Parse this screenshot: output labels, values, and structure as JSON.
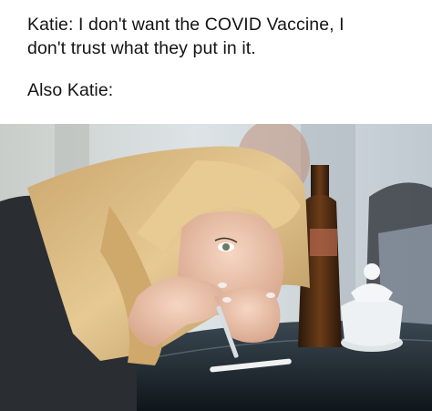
{
  "caption": {
    "line1": "Katie: I don't want the COVID Vaccine, I",
    "line2": "don't trust what they put in it.",
    "line3": "Also Katie:"
  },
  "photo": {
    "subject": "blonde-woman-leaning-over-table",
    "colors": {
      "hair": "#d9b77e",
      "skin": "#efc9b2",
      "shirt": "#2a2d31",
      "table": "#1c252b",
      "bottle": "#4a2a12",
      "background": "#d7dde0"
    }
  }
}
